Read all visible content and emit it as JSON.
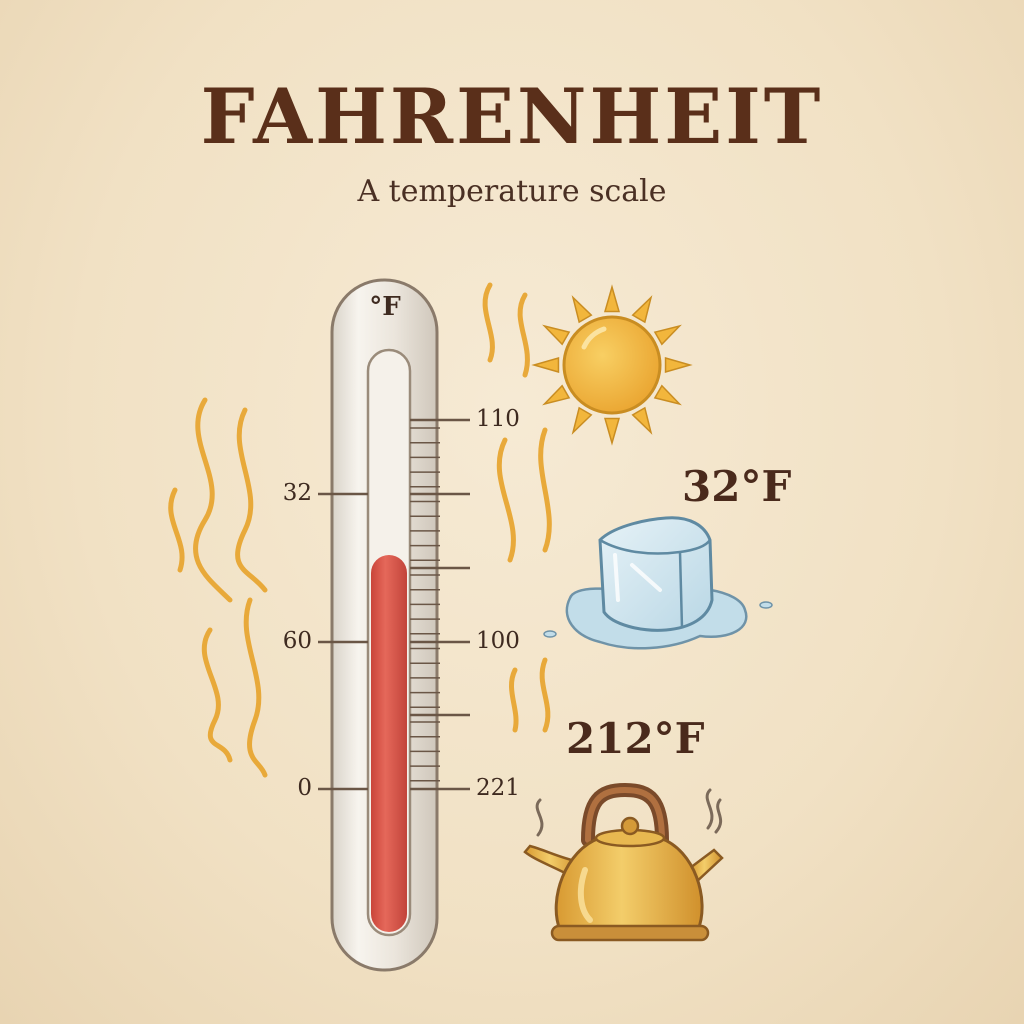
{
  "title": "FAHRENHEIT",
  "subtitle": "A temperature scale",
  "thermometer": {
    "unit": "°F",
    "left_labels": [
      "32",
      "60",
      "0"
    ],
    "right_labels": [
      "110",
      "100",
      "221"
    ],
    "fill_level": 0.65,
    "colors": {
      "mercury": "#d9574a",
      "glass": "#ece6dc",
      "outline": "#8a7a6a"
    }
  },
  "markers": [
    {
      "icon": "sun-icon",
      "label": ""
    },
    {
      "icon": "ice-cube-icon",
      "label": "32°F"
    },
    {
      "icon": "kettle-icon",
      "label": "212°F"
    }
  ],
  "colors": {
    "title": "#5a2f1a",
    "heat_waves": "#e8a93a",
    "sun": "#f2b63c",
    "ice": "#cfe4ee",
    "kettle": "#e9b54a"
  }
}
